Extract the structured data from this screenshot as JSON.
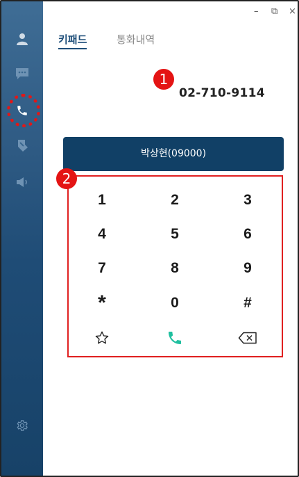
{
  "window_controls": {
    "minimize": "–",
    "restore": "⧉",
    "close": "×"
  },
  "sidebar": {
    "items": [
      {
        "name": "contacts",
        "icon": "person-icon"
      },
      {
        "name": "messages",
        "icon": "chat-icon"
      },
      {
        "name": "calls",
        "icon": "phone-icon",
        "active": true
      },
      {
        "name": "forward",
        "icon": "forward-icon"
      },
      {
        "name": "announce",
        "icon": "speaker-icon"
      },
      {
        "name": "settings",
        "icon": "gear-icon"
      }
    ]
  },
  "tabs": [
    {
      "label": "키패드",
      "active": true
    },
    {
      "label": "통화내역",
      "active": false
    }
  ],
  "display": {
    "number": "02-710-9114"
  },
  "callouts": {
    "first": "1",
    "second": "2"
  },
  "contact": {
    "label": "박상현(09000)"
  },
  "keypad": {
    "keys": [
      "1",
      "2",
      "3",
      "4",
      "5",
      "6",
      "7",
      "8",
      "9",
      "*",
      "0",
      "#"
    ],
    "actions": [
      {
        "name": "favorite",
        "icon": "star-icon"
      },
      {
        "name": "call",
        "icon": "phone-icon",
        "color": "#1fbf9f"
      },
      {
        "name": "backspace",
        "icon": "backspace-icon"
      }
    ]
  },
  "colors": {
    "sidebar": "#1f4c76",
    "accent": "#114066",
    "callout": "#e41414",
    "call": "#1fbf9f"
  }
}
